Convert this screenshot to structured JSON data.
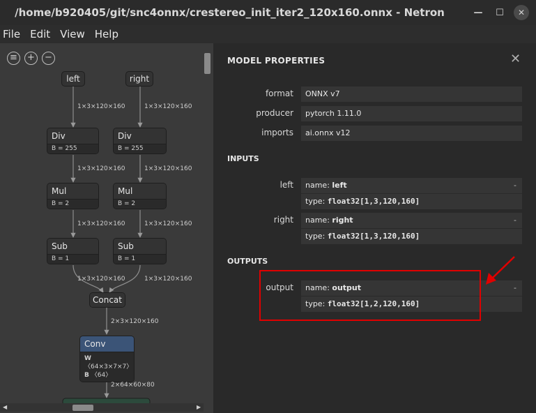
{
  "window": {
    "title": "/home/b920405/git/snc4onnx/crestereo_init_iter2_120x160.onnx - Netron",
    "minimize_glyph": "—",
    "maximize_glyph": "☐",
    "close_glyph": "✕"
  },
  "menu": [
    "File",
    "Edit",
    "View",
    "Help"
  ],
  "graph": {
    "inputs": [
      {
        "label": "left",
        "edge": "1×3×120×160"
      },
      {
        "label": "right",
        "edge": "1×3×120×160"
      }
    ],
    "div_nodes": [
      {
        "op": "Div",
        "attr": "B = 255",
        "edge": "1×3×120×160"
      },
      {
        "op": "Div",
        "attr": "B = 255",
        "edge": "1×3×120×160"
      }
    ],
    "mul_nodes": [
      {
        "op": "Mul",
        "attr": "B = 2",
        "edge": "1×3×120×160"
      },
      {
        "op": "Mul",
        "attr": "B = 2",
        "edge": "1×3×120×160"
      }
    ],
    "sub_nodes": [
      {
        "op": "Sub",
        "attr": "B = 1",
        "edge": "1×3×120×160"
      },
      {
        "op": "Sub",
        "attr": "B = 1",
        "edge": "1×3×120×160"
      }
    ],
    "concat": {
      "op": "Concat",
      "edge": "2×3×120×160"
    },
    "conv": {
      "op": "Conv",
      "attr_w_key": "W",
      "attr_w_val": "〈64×3×7×7〉",
      "attr_b_key": "B",
      "attr_b_val": "〈64〉",
      "edge": "2×64×60×80"
    },
    "toolbar_icons": [
      "menu-icon",
      "zoom-in-icon",
      "zoom-out-icon"
    ],
    "colors": {
      "background": "#3a3a3a",
      "conv_header": "#3b5477",
      "concat": "#4a3c38"
    }
  },
  "properties": {
    "title": "MODEL PROPERTIES",
    "close_glyph": "✕",
    "model": [
      {
        "label": "format",
        "value": "ONNX v7"
      },
      {
        "label": "producer",
        "value": "pytorch 1.11.0"
      },
      {
        "label": "imports",
        "value": "ai.onnx v12"
      }
    ],
    "inputs_header": "INPUTS",
    "inputs": [
      {
        "label": "left",
        "name_key": "name: ",
        "name": "left",
        "type_key": "type: ",
        "type": "float32[1,3,120,160]",
        "dash": "-"
      },
      {
        "label": "right",
        "name_key": "name: ",
        "name": "right",
        "type_key": "type: ",
        "type": "float32[1,3,120,160]",
        "dash": "-"
      }
    ],
    "outputs_header": "OUTPUTS",
    "outputs": [
      {
        "label": "output",
        "name_key": "name: ",
        "name": "output",
        "type_key": "type: ",
        "type": "float32[1,2,120,160]",
        "dash": "-"
      }
    ],
    "highlight_color": "#e00000"
  }
}
